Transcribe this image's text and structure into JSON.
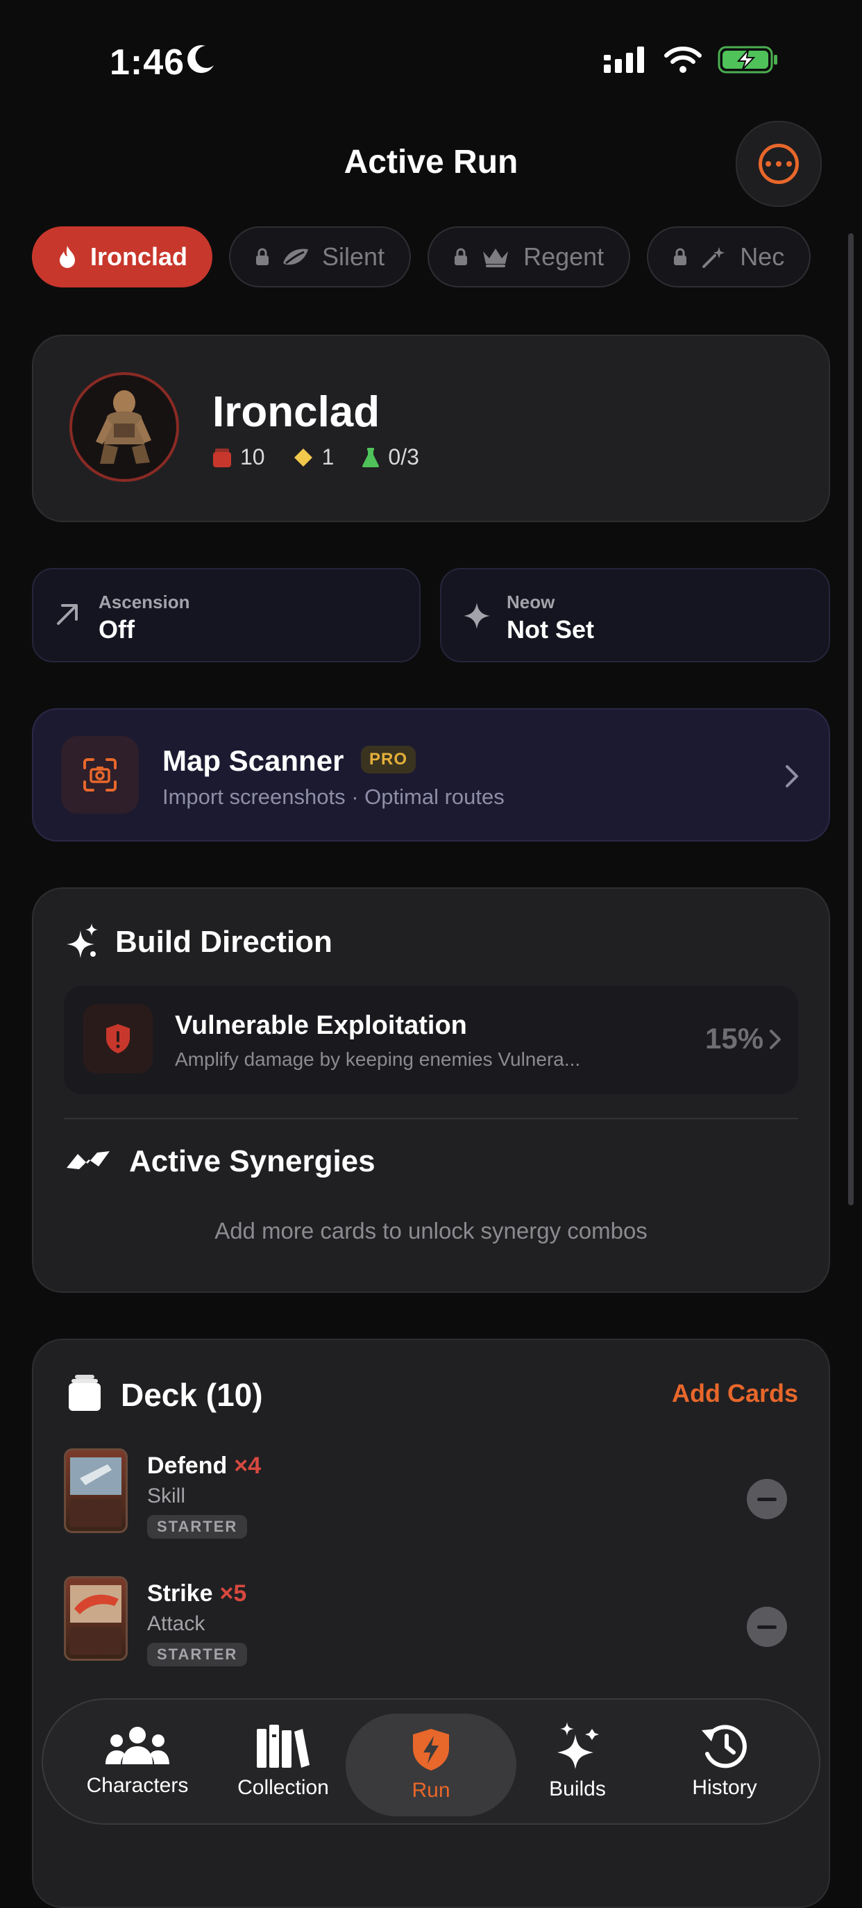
{
  "status_bar": {
    "time": "1:46"
  },
  "header": {
    "title": "Active Run"
  },
  "character_tabs": [
    {
      "label": "Ironclad",
      "locked": false,
      "icon": "flame-icon"
    },
    {
      "label": "Silent",
      "locked": true,
      "icon": "leaf-icon"
    },
    {
      "label": "Regent",
      "locked": true,
      "icon": "crown-icon"
    },
    {
      "label": "Nec",
      "locked": true,
      "icon": "wand-icon"
    }
  ],
  "character": {
    "name": "Ironclad",
    "deck_count": "10",
    "gold": "1",
    "potions": "0/3"
  },
  "ascension": {
    "label": "Ascension",
    "value": "Off"
  },
  "neow": {
    "label": "Neow",
    "value": "Not Set"
  },
  "map_scanner": {
    "title": "Map Scanner",
    "badge": "PRO",
    "subtitle": "Import screenshots · Optimal routes"
  },
  "build_direction": {
    "title": "Build Direction",
    "item": {
      "title": "Vulnerable Exploitation",
      "subtitle": "Amplify damage by keeping enemies Vulnera...",
      "percent": "15%"
    }
  },
  "synergies": {
    "title": "Active Synergies",
    "empty": "Add more cards to unlock synergy combos"
  },
  "deck": {
    "title": "Deck (10)",
    "add_label": "Add Cards",
    "cards": [
      {
        "name": "Defend",
        "count": "×4",
        "type": "Skill",
        "badge": "STARTER"
      },
      {
        "name": "Strike",
        "count": "×5",
        "type": "Attack",
        "badge": "STARTER"
      }
    ]
  },
  "nav": {
    "items": [
      {
        "label": "Characters"
      },
      {
        "label": "Collection"
      },
      {
        "label": "Run"
      },
      {
        "label": "Builds"
      },
      {
        "label": "History"
      }
    ]
  },
  "colors": {
    "accent": "#e8672b",
    "active_tab": "#c8372c",
    "background": "#0c0c0d",
    "card": "#202022"
  }
}
